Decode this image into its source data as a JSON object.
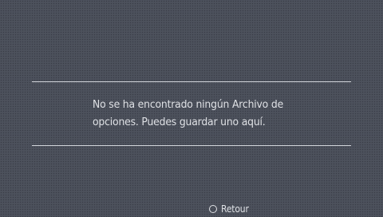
{
  "dialog": {
    "message_line1": "No se ha encontrado ningún Archivo de",
    "message_line2": "opciones. Puedes guardar uno aquí."
  },
  "footer": {
    "back_button_icon": "circle-button-icon",
    "back_label": "Retour"
  },
  "colors": {
    "background": "#4a4f5a",
    "text": "#dfe1e5",
    "divider": "#d4d7dc"
  }
}
